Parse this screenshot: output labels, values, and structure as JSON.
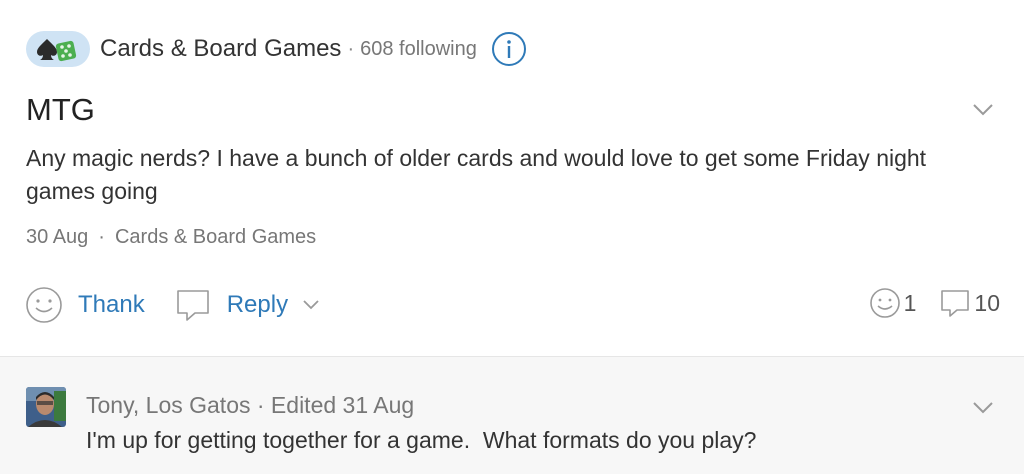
{
  "group": {
    "name": "Cards & Board Games",
    "separator": "·",
    "following": "608 following",
    "icon": "cards-dice-icon",
    "info_icon": "info-icon"
  },
  "post": {
    "title": "MTG",
    "body": "Any magic nerds? I have a bunch of older cards and would love to get some Friday night games going",
    "date": "30 Aug",
    "separator": "·",
    "category": "Cards & Board Games"
  },
  "actions": {
    "thank_label": "Thank",
    "reply_label": "Reply",
    "thanks_count": "1",
    "replies_count": "10"
  },
  "reply": {
    "author_meta": "Tony, Los Gatos · Edited 31 Aug",
    "text": "I'm up for getting together for a game.  What formats do you play?"
  },
  "colors": {
    "link": "#2f7ab8",
    "muted": "#777777",
    "reply_background": "#f7f7f7",
    "group_icon_background": "#cfe3f4"
  }
}
